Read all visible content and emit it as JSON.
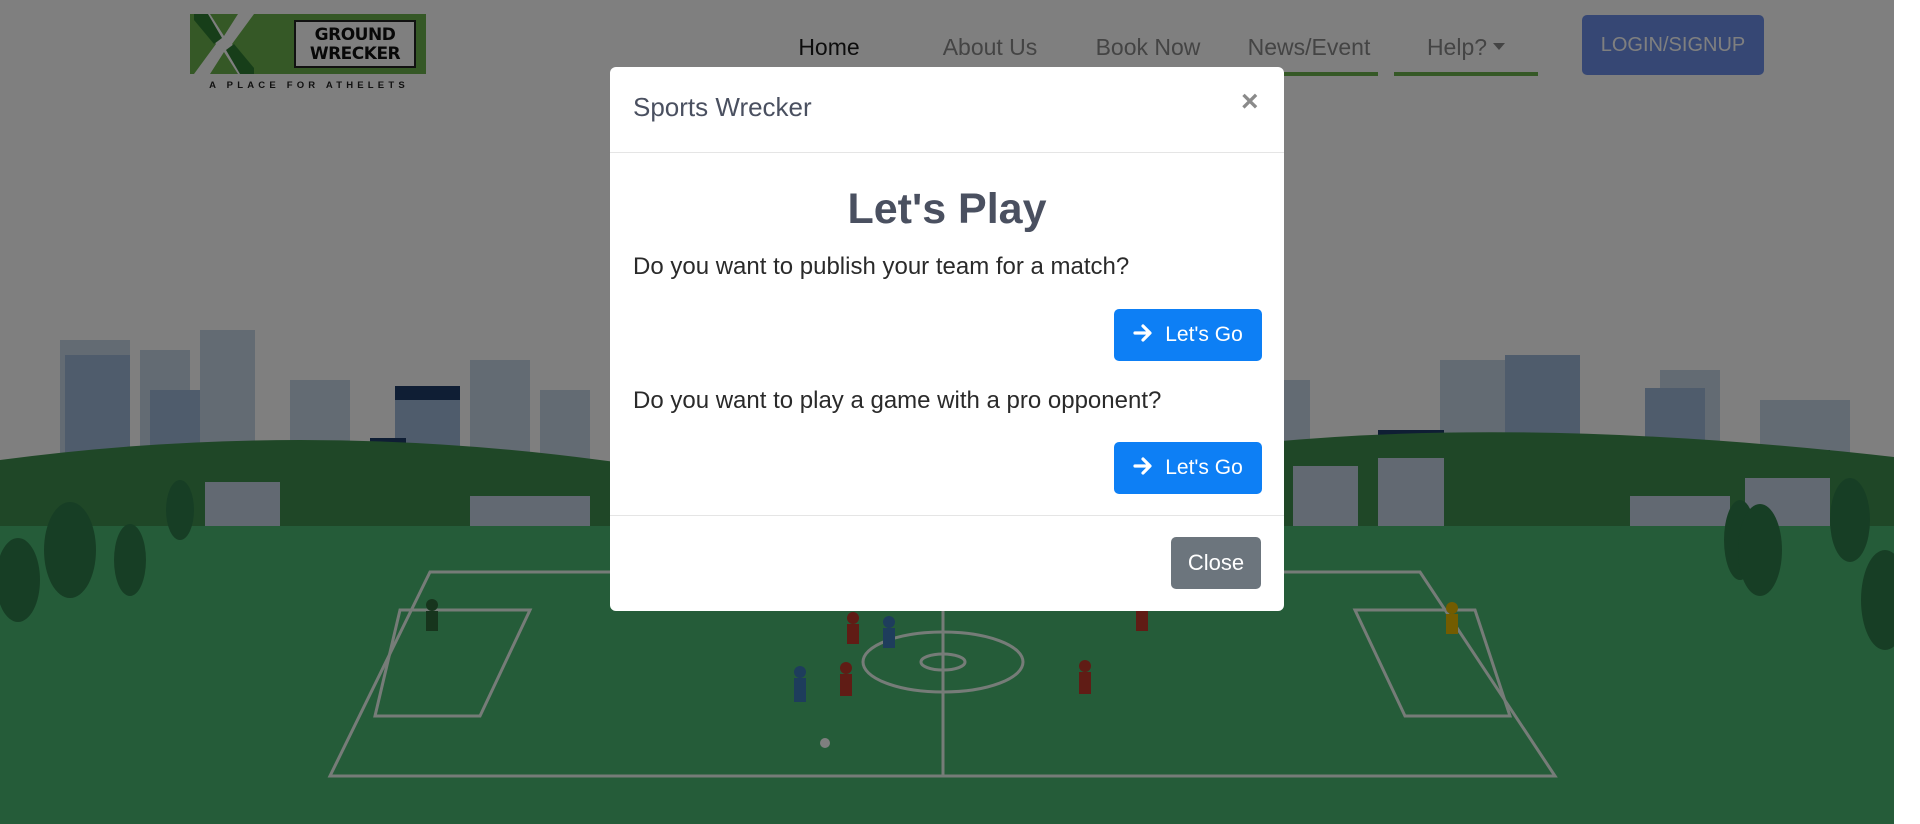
{
  "brand": {
    "name": "GROUND\nWRECKER",
    "tagline": "A PLACE FOR ATHELETS",
    "color": "#6ab04c"
  },
  "nav": {
    "items": [
      {
        "label": "Home"
      },
      {
        "label": "About Us"
      },
      {
        "label": "Book Now"
      },
      {
        "label": "News/Event"
      },
      {
        "label": "Help?"
      }
    ],
    "login_label": "LOGIN/SIGNUP",
    "login_color": "#6c8fe8"
  },
  "hero": {
    "heading": ""
  },
  "modal": {
    "title": "Sports Wrecker",
    "close_icon": "×",
    "heading": "Let's Play",
    "question1": "Do you want to publish your team for a match?",
    "question2": "Do you want to play a game with a pro opponent?",
    "go_label": "Let's Go",
    "go_icon": "arrow-right-icon",
    "close_label": "Close",
    "primary_color": "#0d7ff5",
    "secondary_color": "#6c757d"
  }
}
